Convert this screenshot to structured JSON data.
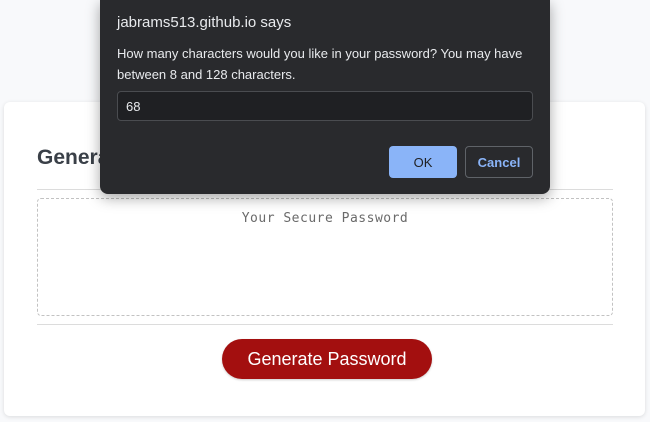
{
  "page": {
    "card_title": "Generate a Password",
    "password_placeholder": "Your Secure Password",
    "generate_button_label": "Generate Password",
    "colors": {
      "generate_button": "#a30f0f",
      "background": "#f8f9fb"
    }
  },
  "dialog": {
    "origin_text": "jabrams513.github.io says",
    "message": "How many characters would you like in your password? You may have between 8 and 128 characters.",
    "input_value": "68",
    "ok_label": "OK",
    "cancel_label": "Cancel",
    "colors": {
      "background": "#292a2d",
      "ok_button": "#8ab4f8"
    }
  }
}
